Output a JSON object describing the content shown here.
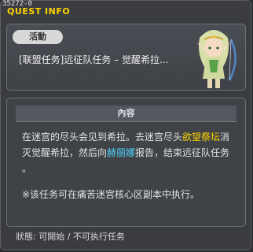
{
  "window": {
    "quest_id": "35272-0",
    "title": "QUEST INFO"
  },
  "top": {
    "tag": "活動",
    "quest_name": "[联盟任务]远征队任务 – 觉醒希拉..."
  },
  "content": {
    "header": "內容",
    "line1_a": "在迷宫的尽头会见到希拉。去迷宫尽头",
    "line1_hl": "欲望祭坛",
    "line1_b": "消",
    "line2_a": "灭觉醒希拉，然后向",
    "line2_hl": "赫丽娜",
    "line2_b": "报告，结束远征队任务",
    "line3": "。",
    "note": "※该任务可在痛苦迷宫核心区副本中执行。"
  },
  "status": {
    "text": "狀態: 可開始 / 不可执行任务"
  },
  "colors": {
    "title": "#ffd400",
    "highlight_yellow": "#ffd400",
    "highlight_blue": "#4fd6ff"
  }
}
